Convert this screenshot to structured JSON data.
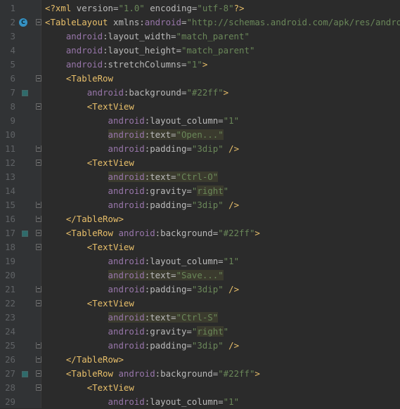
{
  "editor": {
    "language": "xml",
    "colors": {
      "background": "#2b2b2b",
      "gutter": "#313335",
      "line_number": "#606366",
      "tag": "#e8bf6a",
      "attribute_namespace": "#9876aa",
      "attribute_name": "#bababa",
      "string_value": "#6a8759",
      "highlight": "#3b3b2e"
    },
    "lines": [
      {
        "n": "1",
        "tokens": [
          {
            "t": "<?xml version=\"1.0\" encoding=\"utf-8\"?>",
            "k": "plain-decl"
          }
        ]
      },
      {
        "n": "2",
        "marker": "class-icon",
        "fold": "start",
        "tokens": [
          {
            "t": "<TableLayout ",
            "k": "tag"
          },
          {
            "t": "xmlns:",
            "k": "attr"
          },
          {
            "t": "android",
            "k": "ns"
          },
          {
            "t": "=",
            "k": "attr"
          },
          {
            "t": "\"http://schemas.android.com/apk/res/android\"",
            "k": "val"
          }
        ]
      },
      {
        "n": "3",
        "tokens": [
          {
            "t": "    "
          },
          {
            "t": "android",
            "k": "ns"
          },
          {
            "t": ":layout_width=",
            "k": "attr"
          },
          {
            "t": "\"match_parent\"",
            "k": "val"
          }
        ]
      },
      {
        "n": "4",
        "tokens": [
          {
            "t": "    "
          },
          {
            "t": "android",
            "k": "ns"
          },
          {
            "t": ":layout_height=",
            "k": "attr"
          },
          {
            "t": "\"match_parent\"",
            "k": "val"
          }
        ]
      },
      {
        "n": "5",
        "tokens": [
          {
            "t": "    "
          },
          {
            "t": "android",
            "k": "ns"
          },
          {
            "t": ":stretchColumns=",
            "k": "attr"
          },
          {
            "t": "\"1\"",
            "k": "val"
          },
          {
            "t": ">",
            "k": "tag"
          }
        ]
      },
      {
        "n": "6",
        "fold": "start",
        "tokens": [
          {
            "t": "    "
          },
          {
            "t": "<TableRow",
            "k": "tag"
          }
        ]
      },
      {
        "n": "7",
        "marker": "swatch-icon",
        "tokens": [
          {
            "t": "        "
          },
          {
            "t": "android",
            "k": "ns"
          },
          {
            "t": ":background=",
            "k": "attr"
          },
          {
            "t": "\"#22ff\"",
            "k": "val"
          },
          {
            "t": ">",
            "k": "tag"
          }
        ]
      },
      {
        "n": "8",
        "fold": "start",
        "tokens": [
          {
            "t": "        "
          },
          {
            "t": "<TextView",
            "k": "tag"
          }
        ]
      },
      {
        "n": "9",
        "tokens": [
          {
            "t": "            "
          },
          {
            "t": "android",
            "k": "ns"
          },
          {
            "t": ":layout_column=",
            "k": "attr"
          },
          {
            "t": "\"1\"",
            "k": "val"
          }
        ]
      },
      {
        "n": "10",
        "tokens": [
          {
            "t": "            "
          },
          {
            "t": "android",
            "k": "ns",
            "hl": true
          },
          {
            "t": ":text=",
            "k": "attr",
            "hl": true
          },
          {
            "t": "\"Open...\"",
            "k": "val",
            "hl": true
          }
        ]
      },
      {
        "n": "11",
        "fold": "end",
        "tokens": [
          {
            "t": "            "
          },
          {
            "t": "android",
            "k": "ns"
          },
          {
            "t": ":padding=",
            "k": "attr"
          },
          {
            "t": "\"3dip\"",
            "k": "val"
          },
          {
            "t": " />",
            "k": "tag"
          }
        ]
      },
      {
        "n": "12",
        "fold": "start",
        "tokens": [
          {
            "t": "        "
          },
          {
            "t": "<TextView",
            "k": "tag"
          }
        ]
      },
      {
        "n": "13",
        "tokens": [
          {
            "t": "            "
          },
          {
            "t": "android",
            "k": "ns",
            "hl": true
          },
          {
            "t": ":text=",
            "k": "attr",
            "hl": true
          },
          {
            "t": "\"Ctrl-O\"",
            "k": "val",
            "hl": true
          }
        ]
      },
      {
        "n": "14",
        "tokens": [
          {
            "t": "            "
          },
          {
            "t": "android",
            "k": "ns"
          },
          {
            "t": ":gravity=",
            "k": "attr"
          },
          {
            "t": "\"",
            "k": "val"
          },
          {
            "t": "right",
            "k": "val",
            "hl": true
          },
          {
            "t": "\"",
            "k": "val"
          }
        ]
      },
      {
        "n": "15",
        "fold": "end",
        "tokens": [
          {
            "t": "            "
          },
          {
            "t": "android",
            "k": "ns"
          },
          {
            "t": ":padding=",
            "k": "attr"
          },
          {
            "t": "\"3dip\"",
            "k": "val"
          },
          {
            "t": " />",
            "k": "tag"
          }
        ]
      },
      {
        "n": "16",
        "fold": "end",
        "tokens": [
          {
            "t": "    "
          },
          {
            "t": "</TableRow>",
            "k": "tag"
          }
        ]
      },
      {
        "n": "17",
        "marker": "swatch-icon",
        "fold": "start",
        "tokens": [
          {
            "t": "    "
          },
          {
            "t": "<TableRow ",
            "k": "tag"
          },
          {
            "t": "android",
            "k": "ns"
          },
          {
            "t": ":background=",
            "k": "attr"
          },
          {
            "t": "\"#22ff\"",
            "k": "val"
          },
          {
            "t": ">",
            "k": "tag"
          }
        ]
      },
      {
        "n": "18",
        "fold": "start",
        "tokens": [
          {
            "t": "        "
          },
          {
            "t": "<TextView",
            "k": "tag"
          }
        ]
      },
      {
        "n": "19",
        "tokens": [
          {
            "t": "            "
          },
          {
            "t": "android",
            "k": "ns"
          },
          {
            "t": ":layout_column=",
            "k": "attr"
          },
          {
            "t": "\"1\"",
            "k": "val"
          }
        ]
      },
      {
        "n": "20",
        "tokens": [
          {
            "t": "            "
          },
          {
            "t": "android",
            "k": "ns",
            "hl": true
          },
          {
            "t": ":text=",
            "k": "attr",
            "hl": true
          },
          {
            "t": "\"Save...\"",
            "k": "val",
            "hl": true
          }
        ]
      },
      {
        "n": "21",
        "fold": "end",
        "tokens": [
          {
            "t": "            "
          },
          {
            "t": "android",
            "k": "ns"
          },
          {
            "t": ":padding=",
            "k": "attr"
          },
          {
            "t": "\"3dip\"",
            "k": "val"
          },
          {
            "t": " />",
            "k": "tag"
          }
        ]
      },
      {
        "n": "22",
        "fold": "start",
        "tokens": [
          {
            "t": "        "
          },
          {
            "t": "<TextView",
            "k": "tag"
          }
        ]
      },
      {
        "n": "23",
        "tokens": [
          {
            "t": "            "
          },
          {
            "t": "android",
            "k": "ns",
            "hl": true
          },
          {
            "t": ":text=",
            "k": "attr",
            "hl": true
          },
          {
            "t": "\"Ctrl-S\"",
            "k": "val",
            "hl": true
          }
        ]
      },
      {
        "n": "24",
        "tokens": [
          {
            "t": "            "
          },
          {
            "t": "android",
            "k": "ns"
          },
          {
            "t": ":gravity=",
            "k": "attr"
          },
          {
            "t": "\"",
            "k": "val"
          },
          {
            "t": "right",
            "k": "val",
            "hl": true
          },
          {
            "t": "\"",
            "k": "val"
          }
        ]
      },
      {
        "n": "25",
        "fold": "end",
        "tokens": [
          {
            "t": "            "
          },
          {
            "t": "android",
            "k": "ns"
          },
          {
            "t": ":padding=",
            "k": "attr"
          },
          {
            "t": "\"3dip\"",
            "k": "val"
          },
          {
            "t": " />",
            "k": "tag"
          }
        ]
      },
      {
        "n": "26",
        "fold": "end",
        "tokens": [
          {
            "t": "    "
          },
          {
            "t": "</TableRow>",
            "k": "tag"
          }
        ]
      },
      {
        "n": "27",
        "marker": "swatch-icon",
        "fold": "start",
        "tokens": [
          {
            "t": "    "
          },
          {
            "t": "<TableRow ",
            "k": "tag"
          },
          {
            "t": "android",
            "k": "ns"
          },
          {
            "t": ":background=",
            "k": "attr"
          },
          {
            "t": "\"#22ff\"",
            "k": "val"
          },
          {
            "t": ">",
            "k": "tag"
          }
        ]
      },
      {
        "n": "28",
        "fold": "start",
        "tokens": [
          {
            "t": "        "
          },
          {
            "t": "<TextView",
            "k": "tag"
          }
        ]
      },
      {
        "n": "29",
        "tokens": [
          {
            "t": "            "
          },
          {
            "t": "android",
            "k": "ns"
          },
          {
            "t": ":layout_column=",
            "k": "attr"
          },
          {
            "t": "\"1\"",
            "k": "val"
          }
        ]
      }
    ]
  }
}
